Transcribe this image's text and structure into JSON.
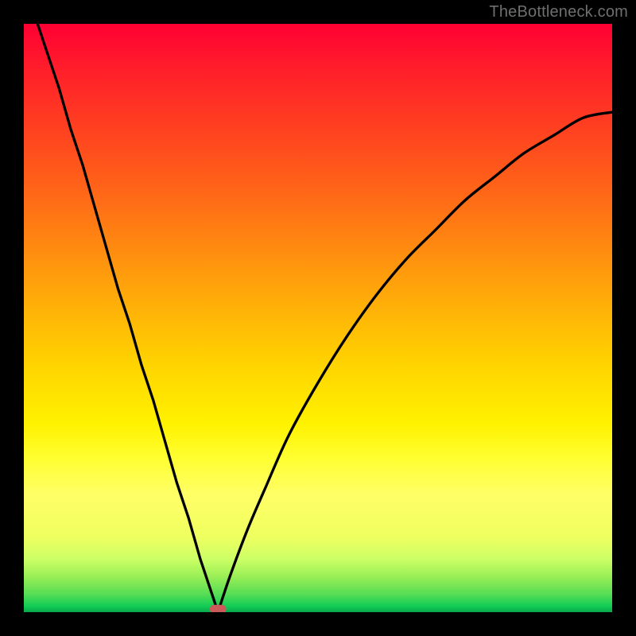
{
  "watermark": {
    "text": "TheBottleneck.com"
  },
  "chart_data": {
    "type": "line",
    "title": "",
    "xlabel": "",
    "ylabel": "",
    "xlim": [
      0,
      100
    ],
    "ylim": [
      0,
      100
    ],
    "grid": false,
    "background_gradient": [
      "#ff0033",
      "#ff8a10",
      "#ffff33",
      "#11cc55"
    ],
    "optimum_x": 33,
    "marker": {
      "x": 33,
      "y": 0.5,
      "shape": "rounded-rect",
      "color": "#cc5a5a"
    },
    "series": [
      {
        "name": "bottleneck-curve-left",
        "x": [
          2,
          4,
          6,
          8,
          10,
          12,
          14,
          16,
          18,
          20,
          22,
          24,
          26,
          28,
          30,
          32,
          33
        ],
        "values": [
          101,
          95,
          89,
          82,
          76,
          69,
          62,
          55,
          49,
          42,
          36,
          29,
          22,
          16,
          9,
          3,
          0
        ]
      },
      {
        "name": "bottleneck-curve-right",
        "x": [
          33,
          35,
          38,
          41,
          45,
          50,
          55,
          60,
          65,
          70,
          75,
          80,
          85,
          90,
          95,
          100
        ],
        "values": [
          0,
          6,
          14,
          21,
          30,
          39,
          47,
          54,
          60,
          65,
          70,
          74,
          78,
          81,
          84,
          85
        ]
      }
    ]
  }
}
